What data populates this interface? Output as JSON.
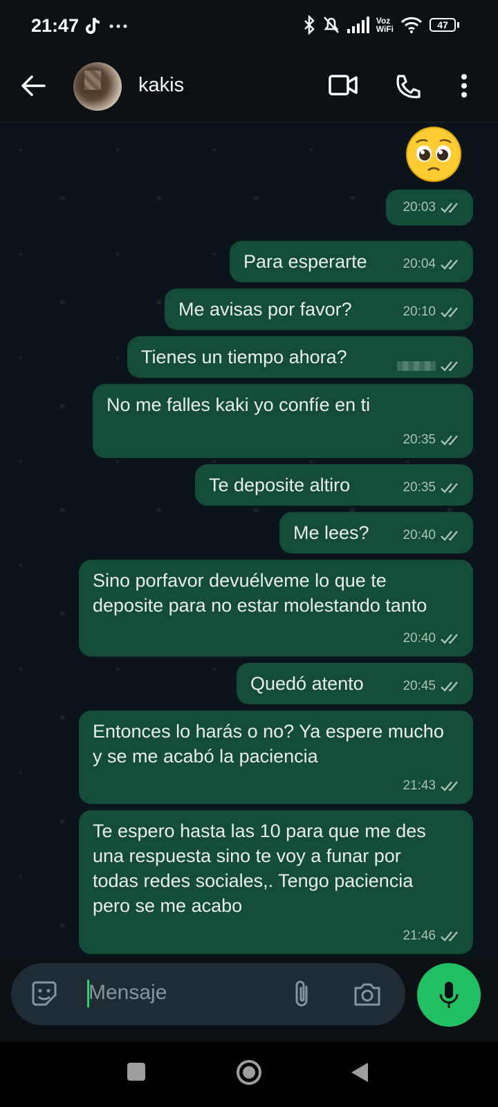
{
  "status_bar": {
    "time": "21:47",
    "network_label_1": "Voz",
    "network_label_2": "WiFi",
    "battery": "47"
  },
  "header": {
    "contact_name": "kakis"
  },
  "messages": [
    {
      "text": "Para esperarte",
      "time": "20:04"
    },
    {
      "text": "Me avisas por favor?",
      "time": "20:10"
    },
    {
      "text": "Tienes un tiempo ahora?",
      "time": ""
    },
    {
      "text": "No me falles kaki yo confíe en ti",
      "time": "20:35"
    },
    {
      "text": "Te deposite altiro",
      "time": "20:35"
    },
    {
      "text": "Me lees?",
      "time": "20:40"
    },
    {
      "text": "Sino porfavor devuélveme lo que te deposite para no estar molestando tanto",
      "time": "20:40"
    },
    {
      "text": "Quedó atento",
      "time": "20:45"
    },
    {
      "text": "Entonces lo harás o no? Ya espere mucho y se me acabó la paciencia",
      "time": "21:43"
    },
    {
      "text": "Te espero hasta las 10 para que me des una respuesta sino te voy a funar por todas redes sociales,. Tengo paciencia pero se me acabo",
      "time": "21:46"
    }
  ],
  "emoji_message": {
    "emoji": "pleading-face",
    "time": "20:03"
  },
  "composer": {
    "placeholder": "Mensaje"
  },
  "colors": {
    "bubble_out": "#144d37",
    "accent": "#21c063"
  }
}
